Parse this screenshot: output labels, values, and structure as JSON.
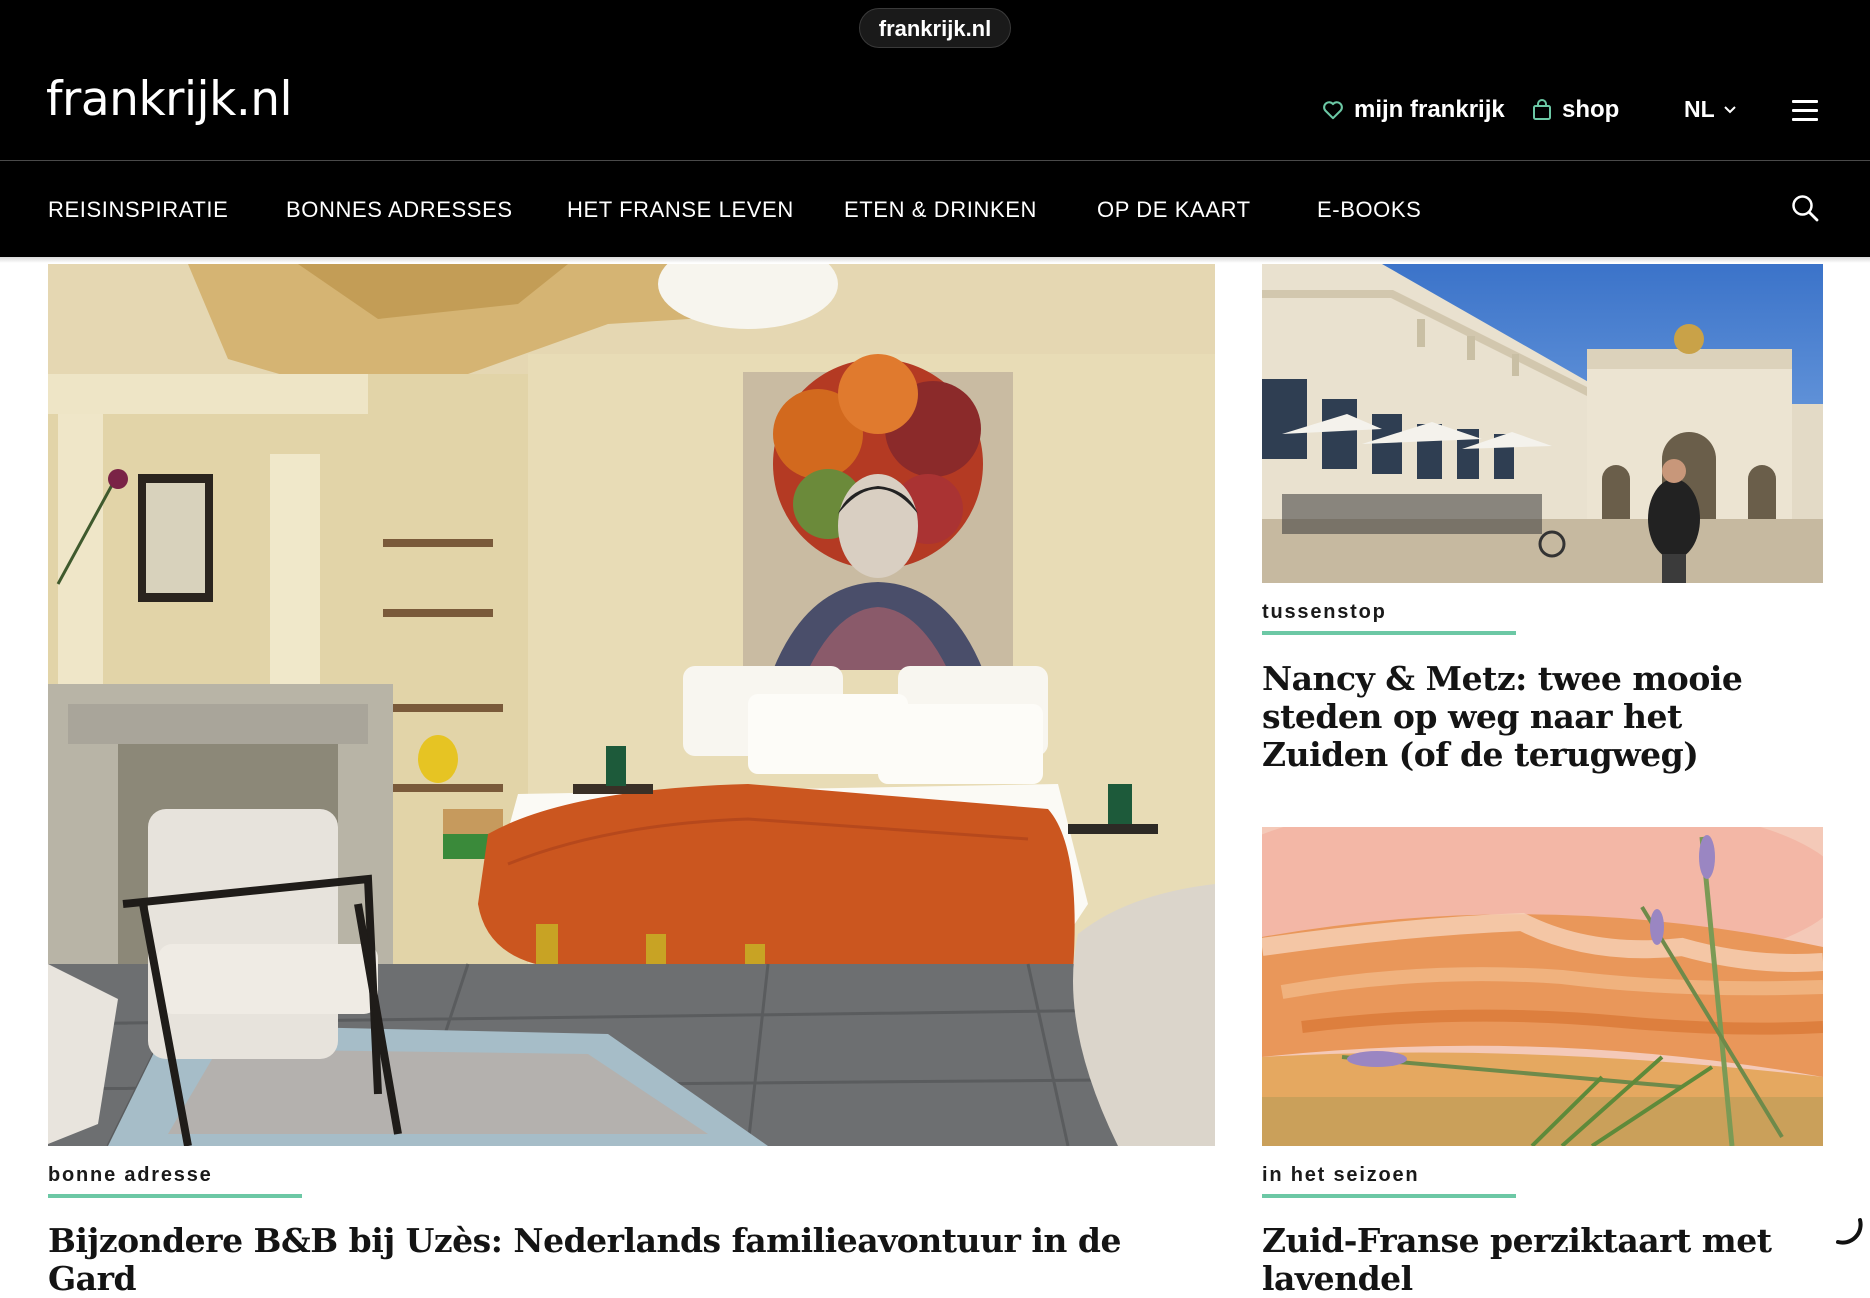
{
  "browser": {
    "url": "frankrijk.nl"
  },
  "header": {
    "logo": "frankrijk.nl",
    "mijn_label": "mijn frankrijk",
    "shop_label": "shop",
    "language": "NL"
  },
  "nav": {
    "items": [
      {
        "label": "REISINSPIRATIE"
      },
      {
        "label": "BONNES ADRESSES"
      },
      {
        "label": "HET FRANSE LEVEN"
      },
      {
        "label": "ETEN & DRINKEN"
      },
      {
        "label": "OP DE KAART"
      },
      {
        "label": "E-BOOKS"
      }
    ]
  },
  "articles": {
    "main": {
      "tag": "bonne adresse",
      "title": "Bijzondere B&B bij Uzès: Nederlands familieavontuur in de Gard"
    },
    "side1": {
      "tag": "tussenstop",
      "title": "Nancy & Metz: twee mooie steden op weg naar het Zuiden (of de terugweg)"
    },
    "side2": {
      "tag": "in het seizoen",
      "title": "Zuid-Franse perziktaart met lavendel"
    }
  },
  "colors": {
    "accent": "#6cc8a5",
    "header_bg": "#000000",
    "heart_icon": "#6cc8a5"
  }
}
